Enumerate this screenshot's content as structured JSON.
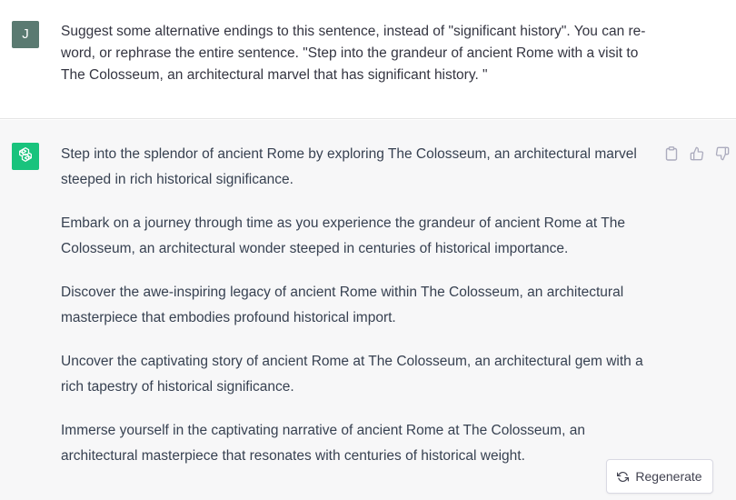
{
  "user": {
    "avatar_letter": "J",
    "avatar_color": "#5a7a71",
    "message": "Suggest some alternative endings to this sentence, instead of \"significant history\". You can re-word, or rephrase the entire sentence. \"Step into the grandeur of ancient Rome with a visit to The Colosseum, an architectural marvel that has significant history. \""
  },
  "assistant": {
    "avatar_icon": "openai-logo-icon",
    "avatar_color": "#19c37d",
    "paragraphs": [
      "Step into the splendor of ancient Rome by exploring The Colosseum, an architectural marvel steeped in rich historical significance.",
      "Embark on a journey through time as you experience the grandeur of ancient Rome at The Colosseum, an architectural wonder steeped in centuries of historical importance.",
      "Discover the awe-inspiring legacy of ancient Rome within The Colosseum, an architectural masterpiece that embodies profound historical import.",
      "Uncover the captivating story of ancient Rome at The Colosseum, an architectural gem with a rich tapestry of historical significance.",
      "Immerse yourself in the captivating narrative of ancient Rome at The Colosseum, an architectural masterpiece that resonates with centuries of historical weight."
    ],
    "actions": [
      "copy-icon",
      "thumbs-up-icon",
      "thumbs-down-icon"
    ]
  },
  "regenerate": {
    "label": "Regenerate",
    "icon": "refresh-icon"
  }
}
